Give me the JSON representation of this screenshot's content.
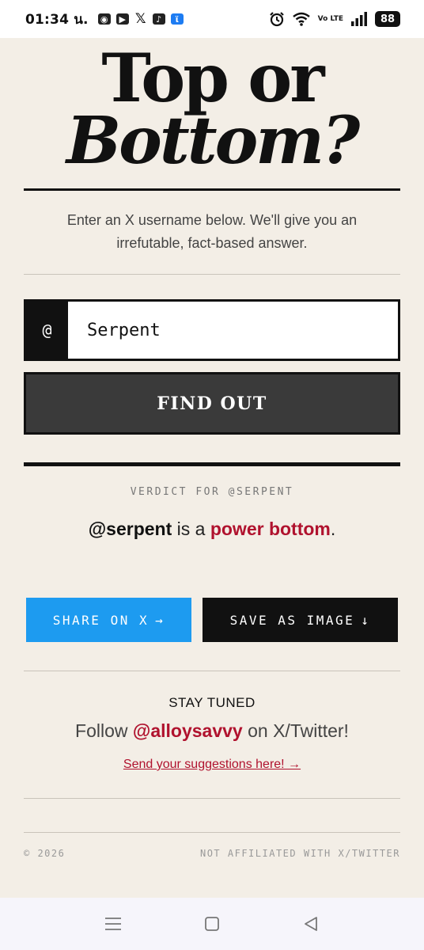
{
  "status_bar": {
    "time": "01:34 น.",
    "battery": "88",
    "network": "Vo LTE",
    "apps": [
      "discord-icon",
      "youtube-icon",
      "x-icon",
      "tiktok-icon",
      "flashlight-icon"
    ]
  },
  "header": {
    "title_line1": "Top or",
    "title_line2": "Bottom?"
  },
  "intro": "Enter an X username below. We'll give you an irrefutable, fact-based answer.",
  "form": {
    "prefix": "@",
    "username_value": "Serpent",
    "submit_label": "FIND OUT"
  },
  "verdict": {
    "label": "VERDICT FOR @SERPENT",
    "handle": "@serpent",
    "connector": " is a ",
    "result": "power bottom",
    "end": "."
  },
  "actions": {
    "share_label": "SHARE ON X",
    "share_arrow": "→",
    "save_label": "SAVE AS IMAGE",
    "save_arrow": "↓"
  },
  "stay_tuned": {
    "heading": "STAY TUNED",
    "follow_prefix": "Follow ",
    "follow_handle": "@alloysavvy",
    "follow_suffix": " on X/Twitter!",
    "suggest_link": "Send your suggestions here! →"
  },
  "footer": {
    "copyright": "© 2026",
    "disclaimer": "NOT AFFILIATED WITH X/TWITTER"
  },
  "colors": {
    "background": "#f3eee6",
    "accent_red": "#b0122e",
    "share_blue": "#1d9bf0",
    "dark": "#111111"
  }
}
